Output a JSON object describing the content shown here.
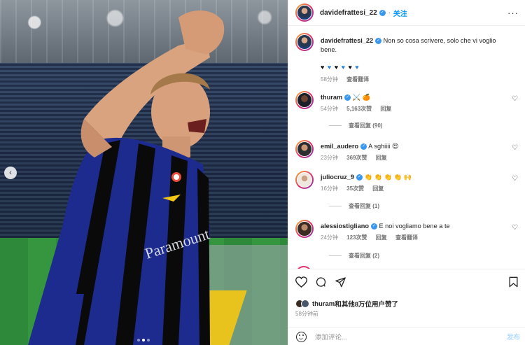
{
  "post": {
    "author": "davidefrattesi_22",
    "follow_label": "关注",
    "more_icon": "more-horizontal-icon",
    "caption": "Non so cosa scrivere, solo che vi voglio bene.",
    "caption_hearts": [
      "black",
      "blue",
      "black",
      "blue",
      "black",
      "blue"
    ],
    "caption_time": "58分钟",
    "caption_translate": "查看翻译",
    "slide_index": 1,
    "slide_count": 3
  },
  "comments": [
    {
      "user": "thuram",
      "text": "⚔️ 🍊",
      "time": "54分钟",
      "likes": "5,163次赞",
      "reply": "回复",
      "view_replies": "查看回复 (90)"
    },
    {
      "user": "emil_audero",
      "text": "A sghiiii 😍",
      "time": "23分钟",
      "likes": "369次赞",
      "reply": "回复"
    },
    {
      "user": "juliocruz_9",
      "text": "👏 👏 👏 👏 🙌",
      "time": "16分钟",
      "likes": "35次赞",
      "reply": "回复",
      "view_replies": "查看回复 (1)"
    },
    {
      "user": "alessiostigliano",
      "text": "E noi vogliamo bene a te",
      "time": "24分钟",
      "likes": "123次赞",
      "reply": "回复",
      "translate": "查看翻译",
      "view_replies": "查看回复 (2)"
    }
  ],
  "actions": {
    "like_icon": "heart-icon",
    "comment_icon": "comment-icon",
    "share_icon": "share-icon",
    "save_icon": "bookmark-icon",
    "liked_by_user": "thuram",
    "liked_by_rest": "和其他8万位用户赞了",
    "time": "58分钟前",
    "comment_placeholder": "添加评论...",
    "post_label": "发布"
  },
  "colors": {
    "link": "#0095f6",
    "verified": "#3897f0",
    "post_disabled": "#b3dbff"
  }
}
